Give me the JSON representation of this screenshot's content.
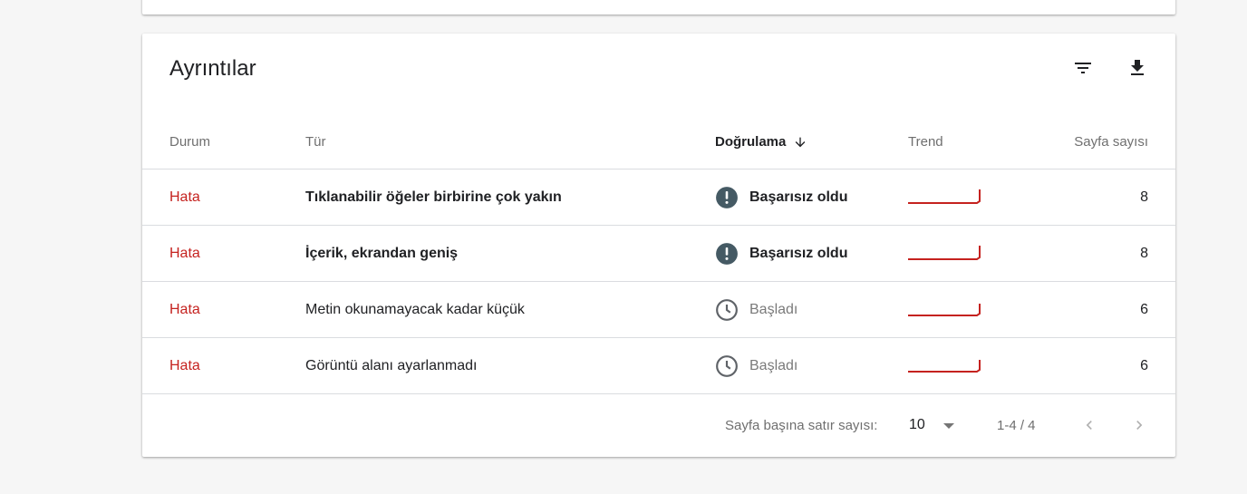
{
  "card": {
    "title": "Ayrıntılar"
  },
  "toolbar": {
    "filter_icon": "filter-icon",
    "download_icon": "download-icon"
  },
  "table": {
    "columns": {
      "status": "Durum",
      "type": "Tür",
      "validation": "Doğrulama",
      "trend": "Trend",
      "pages": "Sayfa sayısı"
    },
    "rows": [
      {
        "status": "Hata",
        "type": "Tıklanabilir öğeler birbirine çok yakın",
        "validation": "Başarısız oldu",
        "validation_icon": "error-icon",
        "pages": "8"
      },
      {
        "status": "Hata",
        "type": "İçerik, ekrandan geniş",
        "validation": "Başarısız oldu",
        "validation_icon": "error-icon",
        "pages": "8"
      },
      {
        "status": "Hata",
        "type": "Metin okunamayacak kadar küçük",
        "validation": "Başladı",
        "validation_icon": "clock-icon",
        "pages": "6"
      },
      {
        "status": "Hata",
        "type": "Görüntü alanı ayarlanmadı",
        "validation": "Başladı",
        "validation_icon": "clock-icon",
        "pages": "6"
      }
    ]
  },
  "pagination": {
    "rows_per_page_label": "Sayfa başına satır sayısı:",
    "rows_per_page_value": "10",
    "range": "1-4 / 4"
  },
  "colors": {
    "error": "#c5221f",
    "trend_line": "#c5221f",
    "icon_dark": "#455a64"
  }
}
